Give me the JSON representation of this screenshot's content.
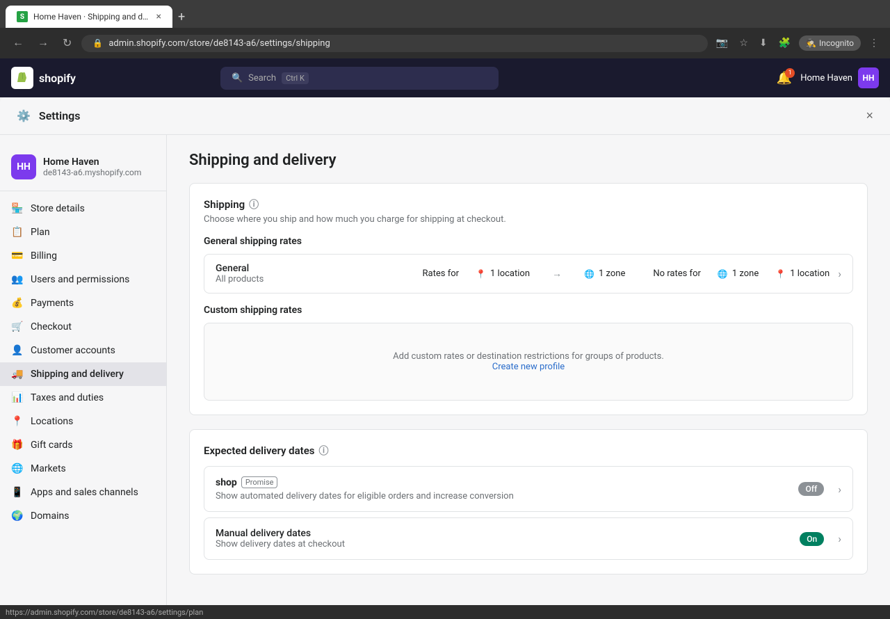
{
  "browser": {
    "tab_title": "Home Haven · Shipping and de...",
    "url": "admin.shopify.com/store/de8143-a6/settings/shipping",
    "new_tab_label": "+",
    "incognito_label": "Incognito"
  },
  "topbar": {
    "logo_text": "shopify",
    "logo_initials": "S",
    "search_placeholder": "Search",
    "search_shortcut": "Ctrl K",
    "notification_count": "1",
    "store_name": "Home Haven",
    "store_initials": "HH"
  },
  "settings": {
    "title": "Settings",
    "close_label": "×"
  },
  "store_info": {
    "name": "Home Haven",
    "initials": "HH",
    "domain": "de8143-a6.myshopify.com"
  },
  "nav": {
    "items": [
      {
        "id": "store-details",
        "label": "Store details",
        "icon": "🏪"
      },
      {
        "id": "plan",
        "label": "Plan",
        "icon": "📋"
      },
      {
        "id": "billing",
        "label": "Billing",
        "icon": "💳"
      },
      {
        "id": "users-permissions",
        "label": "Users and permissions",
        "icon": "👥"
      },
      {
        "id": "payments",
        "label": "Payments",
        "icon": "💰"
      },
      {
        "id": "checkout",
        "label": "Checkout",
        "icon": "🛒"
      },
      {
        "id": "customer-accounts",
        "label": "Customer accounts",
        "icon": "👤"
      },
      {
        "id": "shipping-delivery",
        "label": "Shipping and delivery",
        "icon": "🚚"
      },
      {
        "id": "taxes-duties",
        "label": "Taxes and duties",
        "icon": "📊"
      },
      {
        "id": "locations",
        "label": "Locations",
        "icon": "📍"
      },
      {
        "id": "gift-cards",
        "label": "Gift cards",
        "icon": "🎁"
      },
      {
        "id": "markets",
        "label": "Markets",
        "icon": "🌐"
      },
      {
        "id": "apps-sales-channels",
        "label": "Apps and sales channels",
        "icon": "📱"
      },
      {
        "id": "domains",
        "label": "Domains",
        "icon": "🌍"
      }
    ]
  },
  "main": {
    "page_title": "Shipping and delivery",
    "shipping_section": {
      "heading": "Shipping",
      "description": "Choose where you ship and how much you charge for shipping at checkout.",
      "general_rates_title": "General shipping rates",
      "rate_row": {
        "name": "General",
        "sub": "All products",
        "rates_for_label": "Rates for",
        "rates_location_count": "1 location",
        "rates_zone_count": "1 zone",
        "no_rates_for_label": "No rates for",
        "no_rates_zone_count": "1 zone",
        "no_rates_location_count": "1 location"
      },
      "custom_rates_title": "Custom shipping rates",
      "custom_rates_desc": "Add custom rates or destination restrictions for groups of products.",
      "create_link_label": "Create new profile"
    },
    "delivery_section": {
      "heading": "Expected delivery dates",
      "shop_promise": {
        "shop_text": "shop",
        "promise_badge": "Promise",
        "description": "Show automated delivery dates for eligible orders and increase conversion",
        "toggle_label": "Off"
      },
      "manual_delivery": {
        "title": "Manual delivery dates",
        "description": "Show delivery dates at checkout",
        "toggle_label": "On"
      }
    }
  },
  "status_bar": {
    "url": "https://admin.shopify.com/store/de8143-a6/settings/plan"
  }
}
